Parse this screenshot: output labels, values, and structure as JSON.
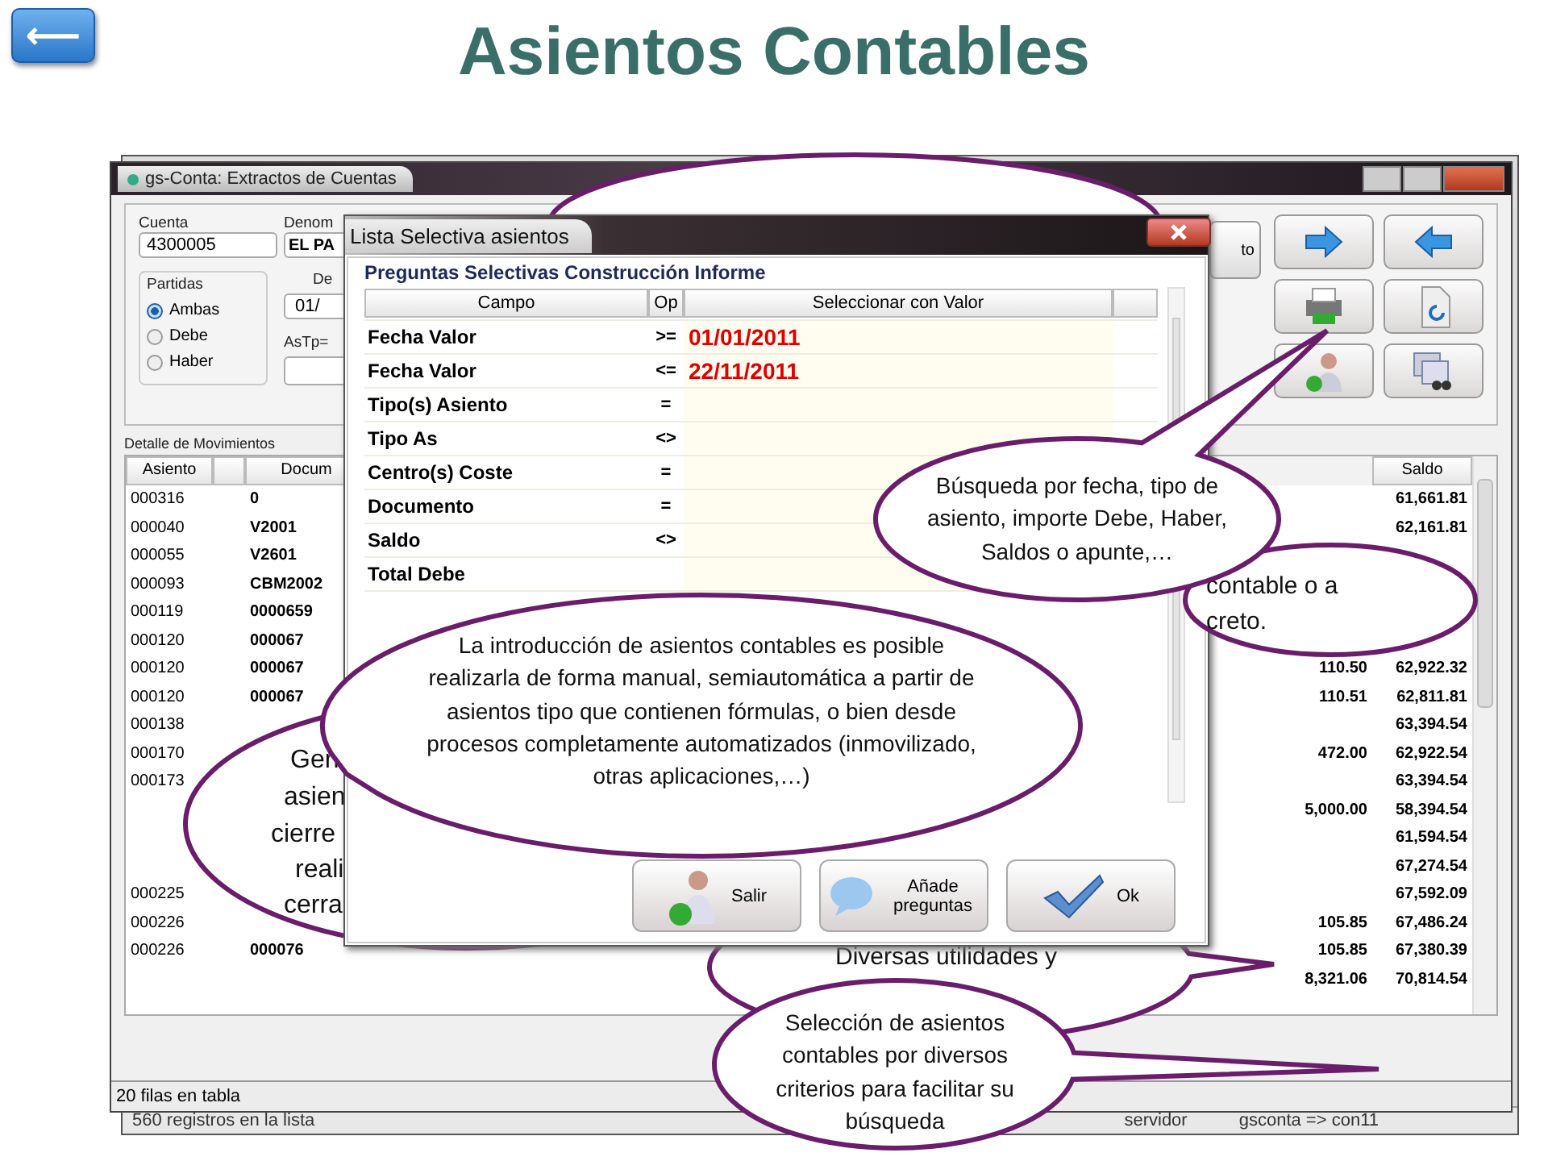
{
  "back_button": {
    "label": "⟵"
  },
  "title": "Asientos Contables",
  "back_window": {
    "status": [
      "560 registros en la lista",
      "servidor",
      "gsconta => con11"
    ]
  },
  "window": {
    "title": "gs-Conta: Extractos de Cuentas",
    "form": {
      "cuenta_label": "Cuenta",
      "cuenta_value": "4300005",
      "denom_label": "Denom",
      "denom_value": "EL PA",
      "de_label": "De",
      "de_value": "01/",
      "astp_label": "AsTp=",
      "partidas": {
        "label": "Partidas",
        "options": [
          {
            "label": "Ambas",
            "selected": true
          },
          {
            "label": "Debe",
            "selected": false
          },
          {
            "label": "Haber",
            "selected": false
          }
        ]
      }
    },
    "cut_button": "to",
    "movements": {
      "title": "Detalle de Movimientos",
      "columns": {
        "asiento": "Asiento",
        "docum": "Docum",
        "saldo": "Saldo"
      },
      "rows": [
        {
          "asiento": "000316",
          "docum": "0",
          "saldo": "61,661.81"
        },
        {
          "asiento": "000040",
          "docum": "V2001",
          "saldo": "62,161.81"
        },
        {
          "asiento": "000055",
          "docum": "V2601"
        },
        {
          "asiento": "000093",
          "docum": "CBM2002"
        },
        {
          "asiento": "000119",
          "docum": "0000659"
        },
        {
          "asiento": "000120",
          "docum": "000067"
        },
        {
          "asiento": "000120",
          "docum": "000067",
          "column_5": "110.50",
          "saldo": "62,922.32"
        },
        {
          "asiento": "000120",
          "docum": "000067",
          "column_5": "110.51",
          "saldo": "62,811.81"
        },
        {
          "asiento": "000138",
          "saldo": "63,394.54"
        },
        {
          "asiento": "000170",
          "column_5": "472.00",
          "saldo": "62,922.54"
        },
        {
          "asiento": "000173",
          "saldo": "63,394.54"
        },
        {
          "column_5": "5,000.00",
          "saldo": "58,394.54"
        },
        {
          "saldo": "61,594.54"
        },
        {
          "saldo": "67,274.54"
        },
        {
          "asiento": "000225",
          "saldo": "67,592.09"
        },
        {
          "asiento": "000226",
          "column_5": "105.85",
          "saldo": "67,486.24"
        },
        {
          "asiento": "000226",
          "docum": "000076",
          "column_5": "105.85",
          "saldo": "67,380.39"
        },
        {
          "column_5": "8,321.06",
          "saldo": "70,814.54"
        }
      ]
    },
    "status": "20 filas en tabla"
  },
  "dialog": {
    "title": "Lista Selectiva asientos",
    "heading": "Preguntas Selectivas Construcción Informe",
    "columns": [
      "Campo",
      "Op",
      "Seleccionar con Valor"
    ],
    "rows": [
      {
        "field": "Fecha Valor",
        "op": ">=",
        "value": "01/01/2011"
      },
      {
        "field": "Fecha Valor",
        "op": "<=",
        "value": "22/11/2011"
      },
      {
        "field": "Tipo(s) Asiento",
        "op": "="
      },
      {
        "field": "Tipo As",
        "op": "<>"
      },
      {
        "field": "Centro(s) Coste",
        "op": "="
      },
      {
        "field": "Documento",
        "op": "="
      },
      {
        "field": "Saldo",
        "op": "<>"
      },
      {
        "field": "Total Debe"
      }
    ],
    "buttons": [
      {
        "kind": "exit",
        "label": "Salir"
      },
      {
        "kind": "add",
        "label": "Añade preguntas"
      },
      {
        "kind": "ok",
        "label": "Ok"
      }
    ]
  },
  "callouts": [
    {
      "lines": [
        "Gen",
        "asien",
        "cierre",
        "reali",
        "cerra"
      ]
    },
    {
      "lines": [
        "Diversas utilidades y"
      ]
    },
    {
      "text": "La introducción de asientos contables es posible realizarla de forma manual, semiautomática a partir de asientos tipo que contienen fórmulas, o bien desde procesos completamente automatizados (inmovilizado, otras aplicaciones,…)"
    },
    {
      "lines": [
        "contable o a",
        "creto."
      ]
    },
    {
      "text": "Búsqueda por fecha, tipo de asiento, importe Debe, Haber, Saldos o apunte,…"
    },
    {
      "text": "Selección de asientos contables por diversos criterios para facilitar su búsqueda"
    }
  ]
}
